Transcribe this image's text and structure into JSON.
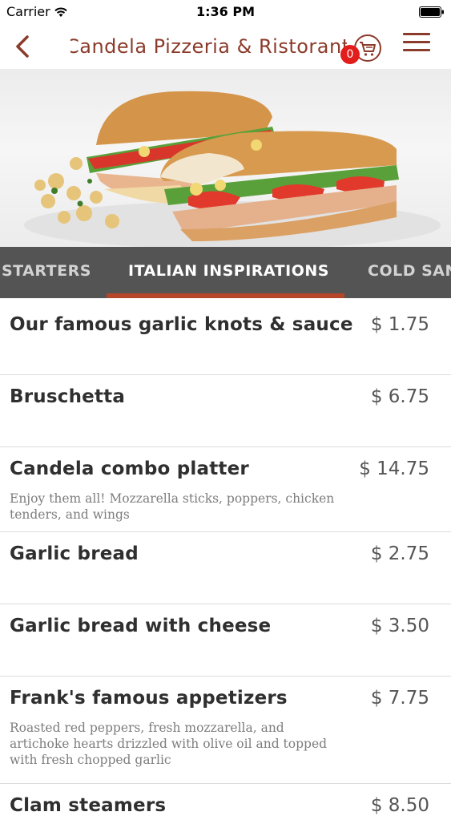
{
  "status_bar": {
    "carrier": "Carrier",
    "time": "1:36 PM"
  },
  "nav": {
    "title": "Candela Pizzeria & Ristorante",
    "cart_count": "0"
  },
  "tabs": [
    {
      "label": "STARTERS",
      "active": false
    },
    {
      "label": "ITALIAN INSPIRATIONS",
      "active": true
    },
    {
      "label": "COLD SAN",
      "active": false
    }
  ],
  "items": [
    {
      "name": "Our famous garlic knots & sauce",
      "price": "$ 1.75",
      "description": ""
    },
    {
      "name": "Bruschetta",
      "price": "$ 6.75",
      "description": ""
    },
    {
      "name": "Candela combo platter",
      "price": "$ 14.75",
      "description": "Enjoy them all! Mozzarella sticks, poppers, chicken tenders, and wings"
    },
    {
      "name": "Garlic bread",
      "price": "$ 2.75",
      "description": ""
    },
    {
      "name": "Garlic bread with cheese",
      "price": "$ 3.50",
      "description": ""
    },
    {
      "name": "Frank's famous appetizers",
      "price": "$ 7.75",
      "description": "Roasted red peppers, fresh mozzarella, and artichoke hearts drizzled with olive oil and topped with fresh chopped garlic"
    },
    {
      "name": "Clam steamers",
      "price": "$ 8.50",
      "description": ""
    }
  ],
  "colors": {
    "brand": "#8b3b2a",
    "tab_bar": "#545454",
    "tab_indicator": "#b5462a",
    "badge": "#e31c1c"
  }
}
